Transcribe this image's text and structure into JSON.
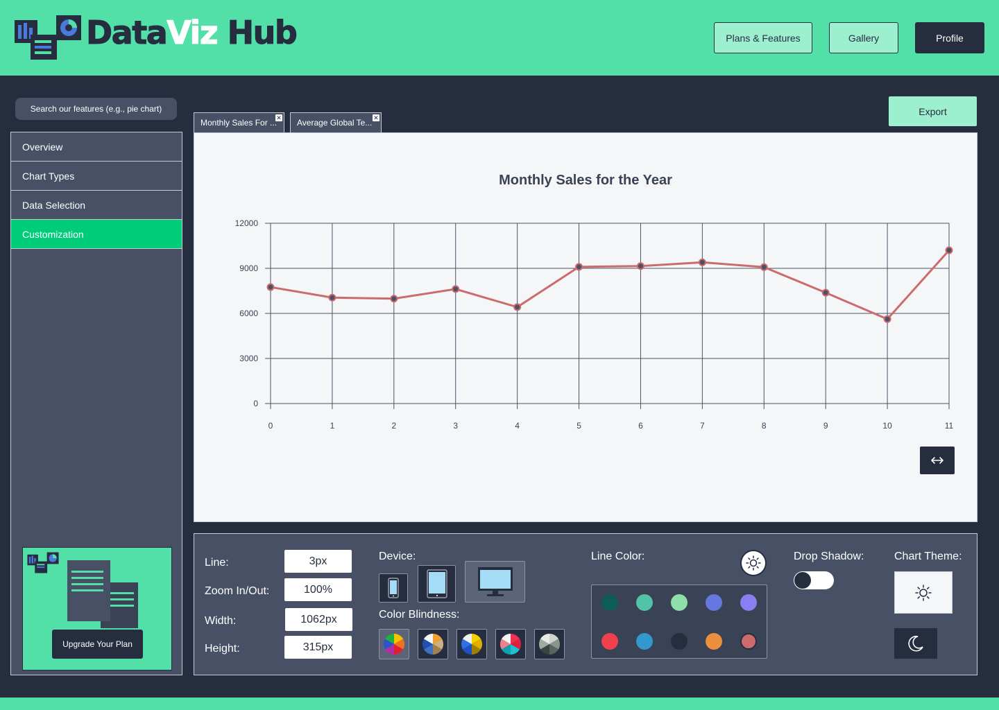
{
  "app": {
    "logo_text_1": "Data",
    "logo_text_2": "Viz",
    "logo_text_3": "Hub"
  },
  "header": {
    "plans_label": "Plans & Features",
    "gallery_label": "Gallery",
    "profile_label": "Profile"
  },
  "search": {
    "placeholder": "Search our features (e.g., pie chart)"
  },
  "sidebar": {
    "items": [
      {
        "label": "Overview",
        "active": false
      },
      {
        "label": "Chart Types",
        "active": false
      },
      {
        "label": "Data Selection",
        "active": false
      },
      {
        "label": "Customization",
        "active": true
      }
    ],
    "upgrade_label": "Upgrade Your Plan"
  },
  "tabs": [
    {
      "label": "Monthly Sales For ..."
    },
    {
      "label": "Average Global Te..."
    }
  ],
  "export_label": "Export",
  "chart_data": {
    "type": "line",
    "title": "Monthly Sales for the Year",
    "x": [
      0,
      1,
      2,
      3,
      4,
      5,
      6,
      7,
      8,
      9,
      10,
      11
    ],
    "series": [
      {
        "values": [
          7750,
          7050,
          6980,
          7620,
          6420,
          9100,
          9150,
          9400,
          9080,
          7380,
          5620,
          10200
        ]
      }
    ],
    "xlim": [
      0,
      11
    ],
    "ylim": [
      0,
      12000
    ],
    "yticks": [
      0,
      3000,
      6000,
      9000,
      12000
    ],
    "grid": true,
    "line_color": "#cc6b6b",
    "marker_color": "#4a5168"
  },
  "controls": {
    "line_label": "Line:",
    "line_value": "3px",
    "zoom_label": "Zoom In/Out:",
    "zoom_value": "100%",
    "width_label": "Width:",
    "width_value": "1062px",
    "height_label": "Height:",
    "height_value": "315px",
    "device_label": "Device:",
    "devices": [
      "phone-icon",
      "tablet-icon",
      "desktop-icon"
    ],
    "selected_device": "desktop",
    "color_blind_label": "Color Blindness:",
    "line_color_label": "Line Color:",
    "swatch_colors": [
      "#0e5c58",
      "#52c3a6",
      "#8fdfa8",
      "#6678e0",
      "#8b7ef0",
      "#f0404d",
      "#3399cc",
      "#262d3f",
      "#ec8f3e",
      "#cc6b6b"
    ],
    "selected_swatch": "#cc6b6b",
    "drop_shadow_label": "Drop Shadow:",
    "drop_shadow_on": false,
    "chart_theme_label": "Chart Theme:"
  },
  "colors": {
    "brand": "#52dfa8",
    "dark": "#262d3f",
    "panel": "#475065",
    "active": "#00cc7a"
  }
}
